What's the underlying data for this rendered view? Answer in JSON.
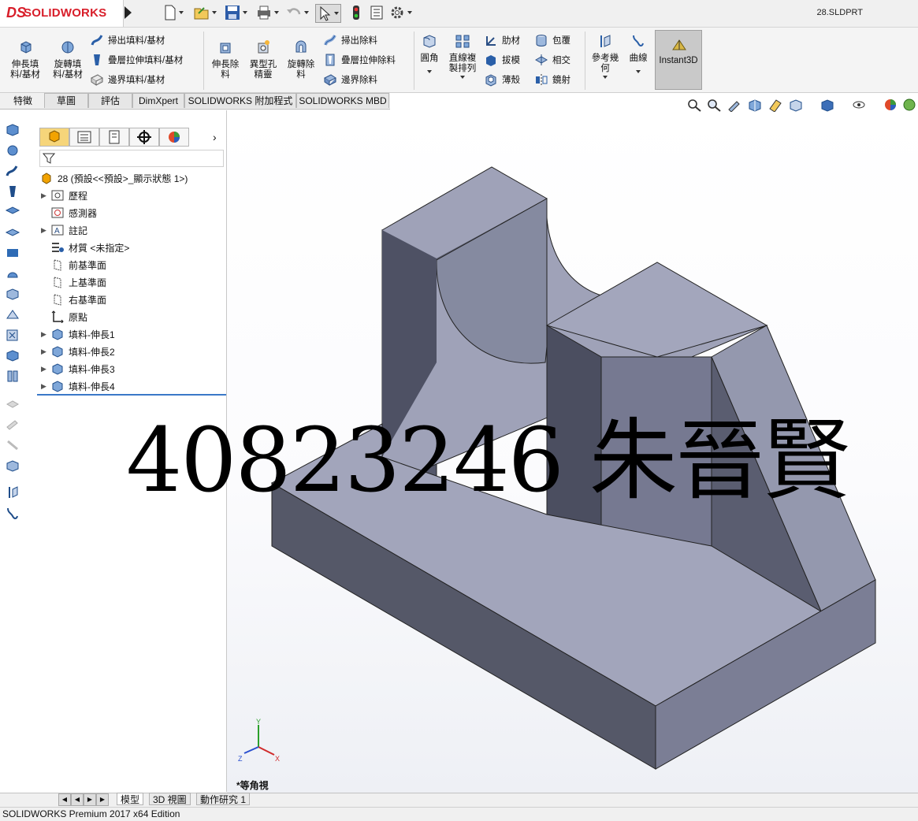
{
  "app": {
    "logo_text": "SOLIDWORKS",
    "document_title": "28.SLDPRT",
    "status_text": "SOLIDWORKS Premium 2017 x64 Edition"
  },
  "ribbon": {
    "big_buttons": [
      {
        "label": "伸長填\n料/基材",
        "icon": "extruded-boss-icon"
      },
      {
        "label": "旋轉填\n料/基材",
        "icon": "revolved-boss-icon"
      },
      {
        "label": "伸長除\n料",
        "icon": "extruded-cut-icon"
      },
      {
        "label": "異型孔\n精靈",
        "icon": "hole-wizard-icon"
      },
      {
        "label": "旋轉除\n料",
        "icon": "revolved-cut-icon"
      },
      {
        "label": "圓角",
        "icon": "fillet-icon"
      },
      {
        "label": "直線複\n製排列",
        "icon": "linear-pattern-icon"
      },
      {
        "label": "參考幾\n何",
        "icon": "reference-geometry-icon"
      },
      {
        "label": "曲線",
        "icon": "curves-icon"
      },
      {
        "label": "Instant3D",
        "icon": "instant3d-icon"
      }
    ],
    "small_buttons": [
      {
        "label": "掃出填料/基材",
        "icon": "swept-boss-icon"
      },
      {
        "label": "疊層拉伸填料/基材",
        "icon": "lofted-boss-icon"
      },
      {
        "label": "邊界填料/基材",
        "icon": "boundary-boss-icon"
      },
      {
        "label": "掃出除料",
        "icon": "swept-cut-icon"
      },
      {
        "label": "疊層拉伸除料",
        "icon": "lofted-cut-icon"
      },
      {
        "label": "邊界除料",
        "icon": "boundary-cut-icon"
      },
      {
        "label": "肋材",
        "icon": "rib-icon"
      },
      {
        "label": "拔模",
        "icon": "draft-icon"
      },
      {
        "label": "薄殼",
        "icon": "shell-icon"
      },
      {
        "label": "包覆",
        "icon": "wrap-icon"
      },
      {
        "label": "相交",
        "icon": "intersect-icon"
      },
      {
        "label": "鏡射",
        "icon": "mirror-icon"
      }
    ]
  },
  "tabs": [
    "特徵",
    "草圖",
    "評估",
    "DimXpert",
    "SOLIDWORKS 附加程式",
    "SOLIDWORKS MBD"
  ],
  "feature_tree": {
    "root": "28 (預設<<預設>_顯示狀態 1>)",
    "items": [
      {
        "label": "歷程",
        "expandable": true,
        "icon": "history-icon"
      },
      {
        "label": "感測器",
        "expandable": false,
        "icon": "sensors-icon"
      },
      {
        "label": "註記",
        "expandable": true,
        "icon": "annotations-icon"
      },
      {
        "label": "材質 <未指定>",
        "expandable": false,
        "icon": "material-icon"
      },
      {
        "label": "前基準面",
        "expandable": false,
        "icon": "plane-icon"
      },
      {
        "label": "上基準面",
        "expandable": false,
        "icon": "plane-icon"
      },
      {
        "label": "右基準面",
        "expandable": false,
        "icon": "plane-icon"
      },
      {
        "label": "原點",
        "expandable": false,
        "icon": "origin-icon"
      },
      {
        "label": "填料-伸長1",
        "expandable": true,
        "icon": "extrude-feature-icon"
      },
      {
        "label": "填料-伸長2",
        "expandable": true,
        "icon": "extrude-feature-icon"
      },
      {
        "label": "填料-伸長3",
        "expandable": true,
        "icon": "extrude-feature-icon"
      },
      {
        "label": "填料-伸長4",
        "expandable": true,
        "icon": "extrude-feature-icon"
      }
    ]
  },
  "viewport": {
    "watermark": "40823246 朱晉賢",
    "view_name": "*等角視",
    "triad_labels": {
      "x": "X",
      "y": "Y",
      "z": "Z"
    }
  },
  "bottom_tabs": [
    "模型",
    "3D 視圖",
    "動作研究 1"
  ],
  "colors": {
    "accent_blue": "#1f63b8",
    "logo_red": "#d81e2a",
    "model_top": "#a2a5bb",
    "model_side_dark": "#555868",
    "model_side_mid": "#767991"
  }
}
